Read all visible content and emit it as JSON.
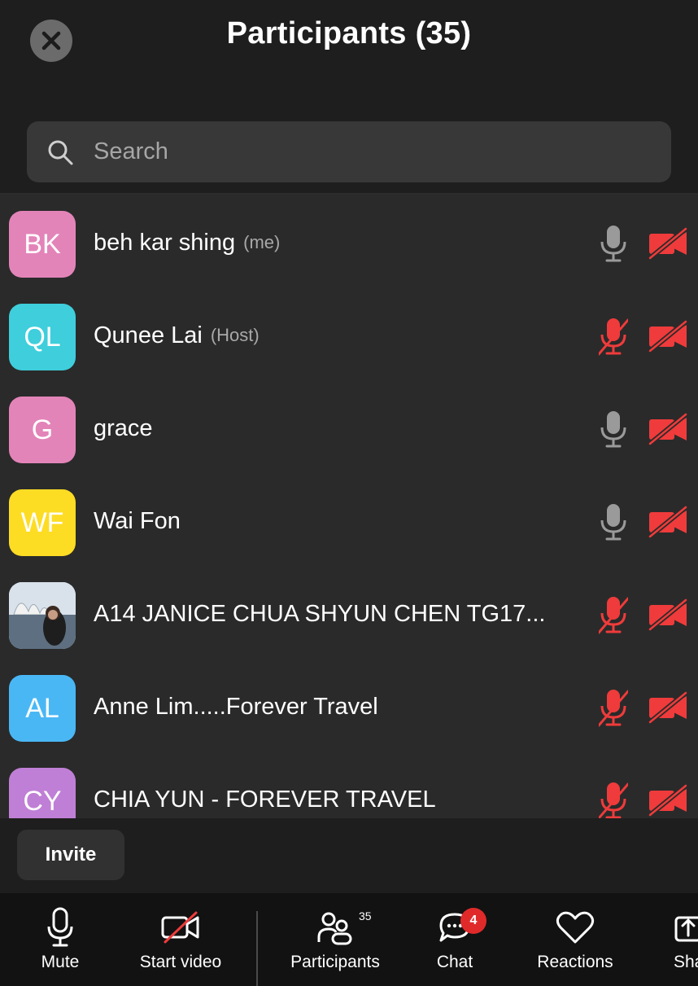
{
  "header": {
    "title": "Participants (35)"
  },
  "search": {
    "placeholder": "Search"
  },
  "participants": [
    {
      "initials": "BK",
      "name": "beh kar shing",
      "tag": "(me)",
      "color": "#e384b9",
      "mic_muted": false,
      "video_off": true
    },
    {
      "initials": "QL",
      "name": "Qunee Lai",
      "tag": "(Host)",
      "color": "#3fcedc",
      "mic_muted": true,
      "video_off": true
    },
    {
      "initials": "G",
      "name": "grace",
      "tag": "",
      "color": "#e384b9",
      "mic_muted": false,
      "video_off": true
    },
    {
      "initials": "WF",
      "name": "Wai Fon",
      "tag": "",
      "color": "#fddc24",
      "mic_muted": false,
      "video_off": true
    },
    {
      "initials": "",
      "name": "A14 JANICE CHUA SHYUN CHEN TG17...",
      "tag": "",
      "color": "#8fa6bb",
      "mic_muted": true,
      "video_off": true,
      "photo": true
    },
    {
      "initials": "AL",
      "name": "Anne Lim.....Forever Travel",
      "tag": "",
      "color": "#4ab7f5",
      "mic_muted": true,
      "video_off": true
    },
    {
      "initials": "CY",
      "name": "CHIA YUN - FOREVER TRAVEL",
      "tag": "",
      "color": "#c07fd6",
      "mic_muted": true,
      "video_off": true
    }
  ],
  "invite_label": "Invite",
  "toolbar": {
    "mute": "Mute",
    "start_video": "Start video",
    "participants": "Participants",
    "participants_count": "35",
    "chat": "Chat",
    "chat_badge": "4",
    "reactions": "Reactions",
    "share": "Share"
  },
  "colors": {
    "muted_red": "#ef3b3b",
    "mic_gray": "#9a9a9a"
  }
}
